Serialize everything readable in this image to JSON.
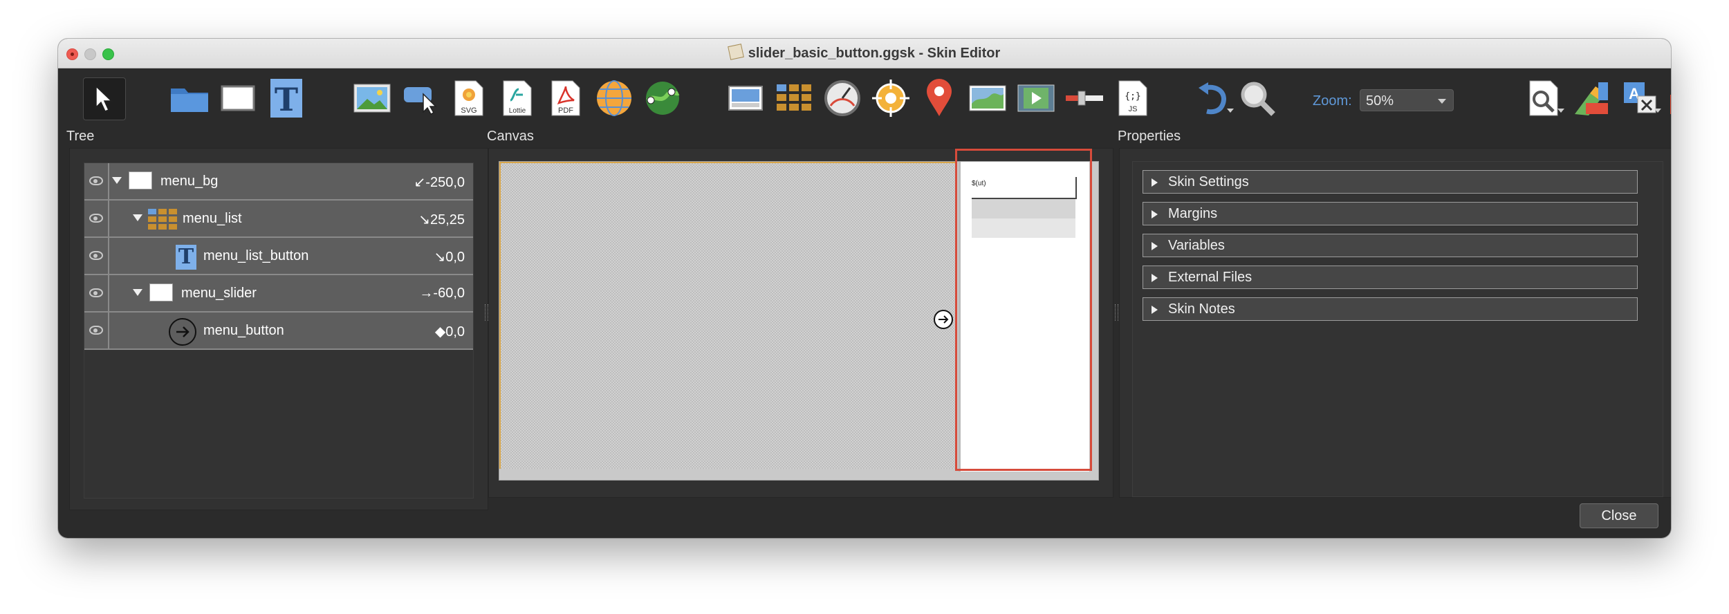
{
  "window": {
    "title": "slider_basic_button.ggsk - Skin Editor"
  },
  "toolbar": {
    "zoom_label": "Zoom:",
    "zoom_value": "50%",
    "tools": [
      "select-tool-icon",
      "folder-icon",
      "rectangle-icon",
      "text-icon",
      "image-icon",
      "cloner-icon",
      "svg-file-icon",
      "lottie-file-icon",
      "pdf-file-icon",
      "sphere-icon",
      "map-icon",
      "view-thumbnail-icon",
      "grid-list-icon",
      "dial-icon",
      "crosshair-icon",
      "map-pin-icon",
      "hotspot-map-icon",
      "video-icon",
      "slider-control-icon",
      "javascript-file-icon",
      "undo-icon",
      "zoom-magnifier-icon",
      "search-document-icon",
      "paint-tools-icon",
      "translate-icon",
      "toolbox-icon"
    ],
    "svg_label": "SVG",
    "lottie_label": "Lottie",
    "pdf_label": "PDF",
    "js_label": "JS",
    "js_braces": "{;}"
  },
  "sections": {
    "tree": "Tree",
    "canvas": "Canvas",
    "properties": "Properties"
  },
  "tree": {
    "rows": [
      {
        "name": "menu_bg",
        "position": "↙-250,0"
      },
      {
        "name": "menu_list",
        "position": "↘25,25"
      },
      {
        "name": "menu_list_button",
        "position": "↘0,0"
      },
      {
        "name": "menu_slider",
        "position": "→-60,0"
      },
      {
        "name": "menu_button",
        "position": "◆0,0"
      }
    ]
  },
  "canvas": {
    "button_text": "$(ut)"
  },
  "properties": {
    "sections": [
      "Skin Settings",
      "Margins",
      "Variables",
      "External Files",
      "Skin Notes"
    ]
  },
  "footer": {
    "close_label": "Close"
  },
  "colors": {
    "window_bg": "#2b2b2b",
    "tree_row_bg": "#5e5e5e",
    "selection_red": "#d64b3b",
    "zoom_label_blue": "#5f98d8"
  }
}
